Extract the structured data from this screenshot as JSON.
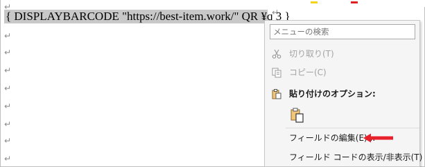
{
  "document": {
    "field_code": "{ DISPLAYBARCODE \"https://best-item.work/\" QR ¥q 3 }",
    "paragraph_mark": "↵"
  },
  "context_menu": {
    "search_placeholder": "メニューの検索",
    "items": [
      {
        "label": "切り取り(T)",
        "icon": "scissors-icon",
        "enabled": false
      },
      {
        "label": "コピー(C)",
        "icon": "copy-icon",
        "enabled": false
      },
      {
        "label": "貼り付けのオプション:",
        "icon": "clipboard-icon",
        "enabled": true
      },
      {
        "label": "フィールドの編集(E)...",
        "icon": "",
        "enabled": true
      },
      {
        "label": "フィールド コードの表示/非表示(T)",
        "icon": "",
        "enabled": true
      }
    ],
    "paste_option_icon": "paste-keep-text-only-icon"
  },
  "annotation": {
    "arrow_color": "#e8202a",
    "arrow_icon": "left-arrow-icon"
  },
  "colors": {
    "field_highlight": "#c8c8c8",
    "menu_background": "#f5f5f5"
  }
}
